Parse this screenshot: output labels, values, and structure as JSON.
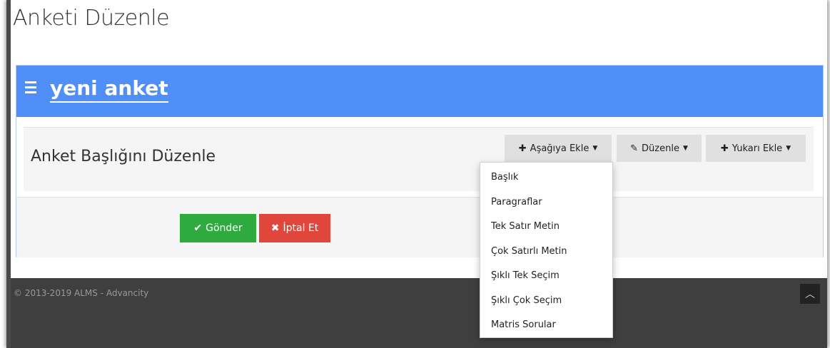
{
  "page": {
    "title": "Anketi Düzenle"
  },
  "panel": {
    "header_title": "yeni anket",
    "subpanel_title": "Anket Başlığını Düzenle",
    "toolbar": {
      "add_below_label": "Aşağıya Ekle",
      "edit_label": "Düzenle",
      "add_above_label": "Yukarı Ekle"
    },
    "footer": {
      "send_label": "Gönder",
      "cancel_label": "İptal Et"
    }
  },
  "dropdown": {
    "items": [
      "Başlık",
      "Paragraflar",
      "Tek Satır Metin",
      "Çok Satırlı Metin",
      "Şıklı Tek Seçim",
      "Şıklı Çok Seçim",
      "Matris Sorular"
    ]
  },
  "footer": {
    "copyright": "© 2013-2019 ALMS - Advancity"
  },
  "icons": {
    "menu": "menu-icon",
    "plus": "plus-icon",
    "edit": "edit-icon",
    "check": "check-icon",
    "close": "close-icon",
    "chevron_up": "chevron-up-icon",
    "caret_down": "caret-down-icon"
  },
  "colors": {
    "header_blue": "#4f8ff7",
    "send_green": "#2eaa3e",
    "cancel_red": "#e0463c",
    "footer_dark": "#3f3f3f"
  }
}
